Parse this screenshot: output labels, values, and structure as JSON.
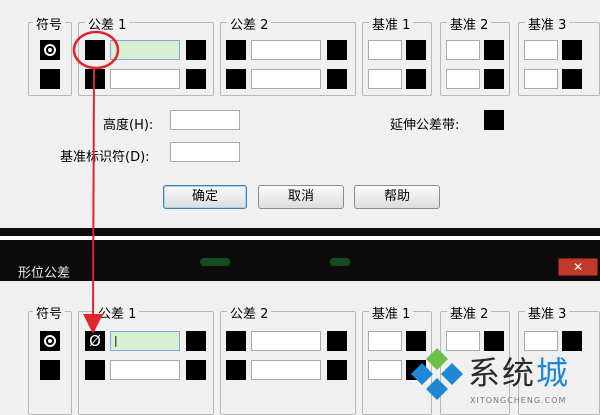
{
  "top_dialog": {
    "groups": {
      "symbol": "符号",
      "tol1": "公差 1",
      "tol2": "公差 2",
      "datum1": "基准 1",
      "datum2": "基准 2",
      "datum3": "基准 3"
    },
    "height_label": "高度(H):",
    "datum_id_label": "基准标识符(D):",
    "projected_zone_label": "延伸公差带:",
    "ok_label": "确定",
    "cancel_label": "取消",
    "help_label": "帮助"
  },
  "bottom_dialog": {
    "window_title": "形位公差",
    "close_glyph": "✕",
    "groups": {
      "symbol": "符号",
      "tol1": "公差 1",
      "tol2": "公差 2",
      "datum1": "基准 1",
      "datum2": "基准 2",
      "datum3": "基准 3"
    },
    "diameter_glyph": "Ø",
    "tol1_value": "|"
  },
  "watermark": {
    "text_main": "系统",
    "text_accent": "城",
    "url": "XITONGCHENG.COM"
  },
  "colors": {
    "dialog_bg": "#f0f0f0",
    "active_field": "#d9efd4",
    "annotation_red": "#e0262b",
    "watermark_blue": "#1e88d6"
  },
  "icons": {
    "symbol_button": "concentricity-icon",
    "diameter": "diameter-icon",
    "close": "close-icon",
    "watermark_logo": "diamond-logo-icon"
  }
}
